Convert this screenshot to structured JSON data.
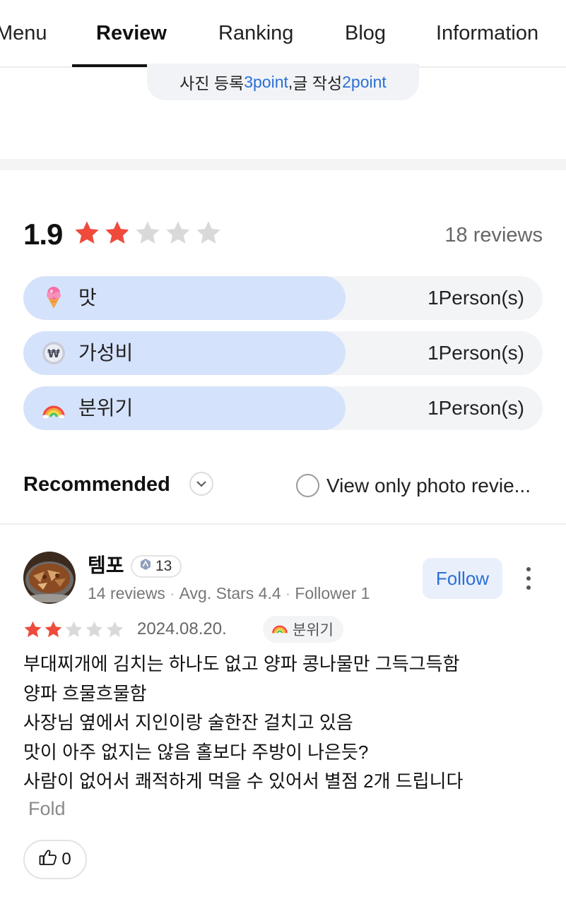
{
  "tabs": [
    {
      "label": "Menu",
      "active": false
    },
    {
      "label": "Review",
      "active": true
    },
    {
      "label": "Ranking",
      "active": false
    },
    {
      "label": "Blog",
      "active": false
    },
    {
      "label": "Information",
      "active": false
    }
  ],
  "points_notice": {
    "photo_prefix": "사진 등록 ",
    "photo_points": "3point",
    "separator": ", ",
    "write_prefix": "글 작성 ",
    "write_points": "2point"
  },
  "rating": {
    "average": "1.9",
    "stars_value": 1.9,
    "stars_max": 5,
    "reviews_count": "18 reviews"
  },
  "breakdown": [
    {
      "icon": "ice-cream-icon",
      "label": "맛",
      "count": "1Person(s)",
      "fill_fraction": 0.62
    },
    {
      "icon": "won-coin-icon",
      "label": "가성비",
      "count": "1Person(s)",
      "fill_fraction": 0.62
    },
    {
      "icon": "rainbow-icon",
      "label": "분위기",
      "count": "1Person(s)",
      "fill_fraction": 0.62
    }
  ],
  "filters": {
    "sort_label": "Recommended",
    "photo_only_label": "View only photo revie..."
  },
  "review": {
    "user_name": "템포",
    "level": "13",
    "user_reviews": "14 reviews",
    "avg_stars": "Avg. Stars 4.4",
    "followers": "Follower 1",
    "follow_label": "Follow",
    "stars_value": 2,
    "date": "2024.08.20.",
    "tag": "분위기",
    "lines": [
      "부대찌개에 김치는 하나도 없고 양파 콩나물만 그득그득함",
      "양파 흐물흐물함",
      "사장님 옆에서 지인이랑 술한잔 걸치고 있음",
      "맛이 아주 없지는 않음 홀보다 주방이 나은듯?",
      "사람이 없어서 쾌적하게 먹을 수 있어서 별점 2개 드립니다"
    ],
    "fold_label": "Fold",
    "likes": "0"
  },
  "colors": {
    "star_red": "#f04a3c",
    "star_gray": "#d9d9d9",
    "accent_blue": "#2b6fd6",
    "bar_fill": "#d5e2fb"
  }
}
